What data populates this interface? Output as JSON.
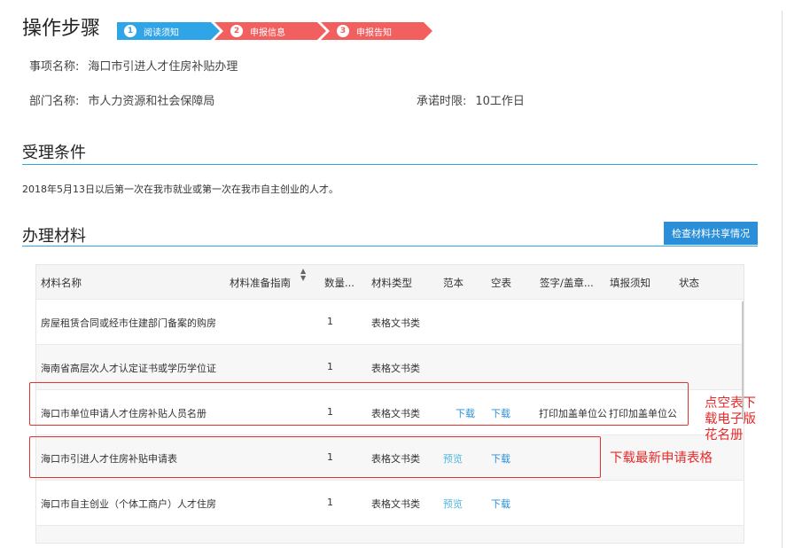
{
  "steps": {
    "title": "操作步骤",
    "items": [
      {
        "num": "1",
        "label": "阅读须知",
        "state": "active"
      },
      {
        "num": "2",
        "label": "申报信息",
        "state": "pending"
      },
      {
        "num": "3",
        "label": "申报告知",
        "state": "pending"
      }
    ]
  },
  "info": {
    "item_label": "事项名称:",
    "item_value": "海口市引进人才住房补贴办理",
    "dept_label": "部门名称:",
    "dept_value": "市人力资源和社会保障局",
    "limit_label": "承诺时限:",
    "limit_value": "10工作日"
  },
  "conditions": {
    "title": "受理条件",
    "text": "2018年5月13日以后第一次在我市就业或第一次在我市自主创业的人才。"
  },
  "materials": {
    "title": "办理材料",
    "share_button": "检查材料共享情况",
    "columns": [
      "材料名称",
      "材料准备指南",
      "数量...",
      "材料类型",
      "范本",
      "空表",
      "签字/盖章...",
      "填报须知",
      "状态"
    ],
    "sort_icon": "sort-icon",
    "rows": [
      {
        "name": "房屋租赁合同或经市住建部门备案的购房",
        "qty": "1",
        "type": "表格文书类",
        "sample": "",
        "blank": "",
        "sign": "",
        "notice": "",
        "status": ""
      },
      {
        "name": "海南省高层次人才认定证书或学历学位证",
        "qty": "1",
        "type": "表格文书类",
        "sample": "",
        "blank": "",
        "sign": "",
        "notice": "",
        "status": ""
      },
      {
        "name": "海口市单位申请人才住房补贴人员名册",
        "qty": "1",
        "type": "表格文书类",
        "sample": "下载",
        "blank": "下载",
        "sign": "打印加盖单位公",
        "notice": "打印加盖单位公",
        "status": ""
      },
      {
        "name": "海口市引进人才住房补贴申请表",
        "qty": "1",
        "type": "表格文书类",
        "sample": "预览",
        "blank": "下载",
        "sign": "",
        "notice": "",
        "status": ""
      },
      {
        "name": "海口市自主创业（个体工商户）人才住房",
        "qty": "1",
        "type": "表格文书类",
        "sample": "预览",
        "blank": "下载",
        "sign": "",
        "notice": "",
        "status": ""
      }
    ]
  },
  "annotations": {
    "note1": "点空表下载电子版花名册",
    "note2": "下载最新申请表格"
  },
  "colors": {
    "step_active": "#2fa4e7",
    "step_pending": "#f25f5f",
    "accent": "#2a8fd8",
    "annotation_red": "#e23232"
  }
}
